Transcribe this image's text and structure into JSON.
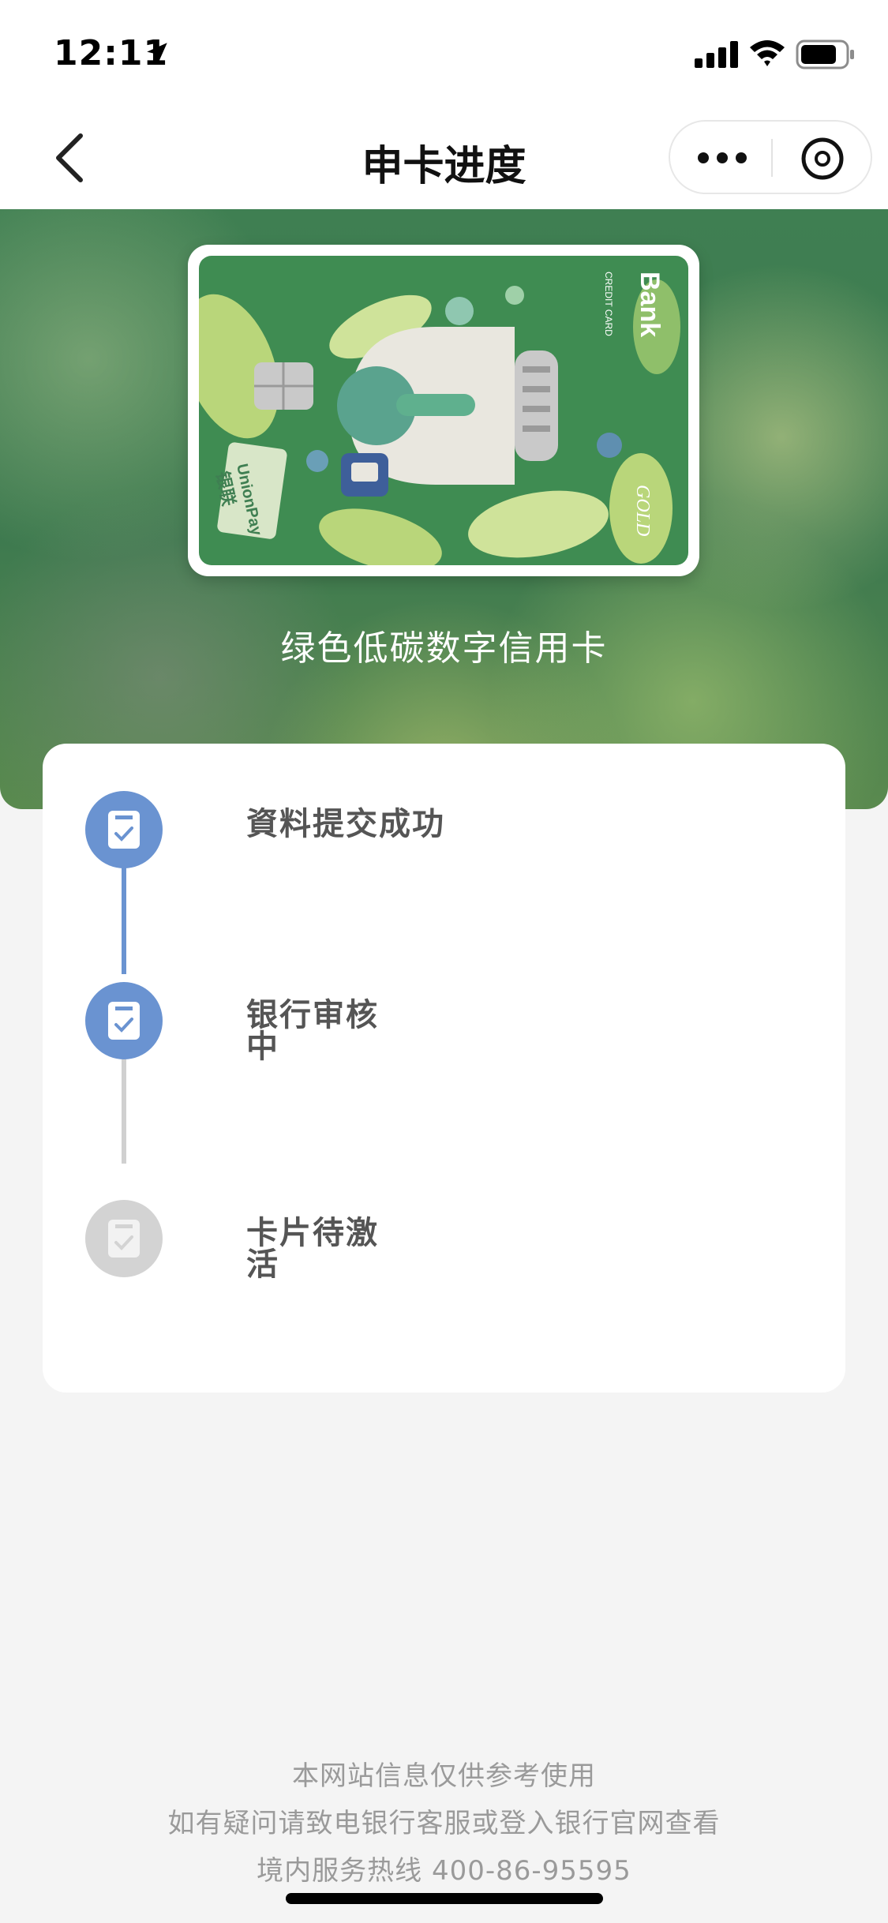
{
  "status_bar": {
    "time": "12:11",
    "icons": [
      "location-arrow-icon",
      "signal-icon",
      "wifi-icon",
      "battery-icon"
    ]
  },
  "nav": {
    "title": "申卡进度",
    "icons": [
      "back-icon",
      "more-icon",
      "close-icon"
    ]
  },
  "card": {
    "name": "绿色低碳数字信用卡",
    "brand_text": "Bank",
    "union_text": "UnionPay",
    "union_cn": "银联",
    "tier": "GOLD",
    "credit_label": "CREDIT CARD"
  },
  "progress": {
    "steps": [
      {
        "label": "資料提交成功",
        "status": "done"
      },
      {
        "label": "银行审核中",
        "status": "done"
      },
      {
        "label": "卡片待激活",
        "status": "pending"
      }
    ]
  },
  "footer": {
    "line1": "本网站信息仅供参考使用",
    "line2": "如有疑问请致电银行客服或登入银行官网查看",
    "line3": "境内服务热线 400-86-95595"
  },
  "colors": {
    "accent": "#6a93d1",
    "inactive": "#d3d3d3",
    "hero_green": "#3f7f52"
  }
}
